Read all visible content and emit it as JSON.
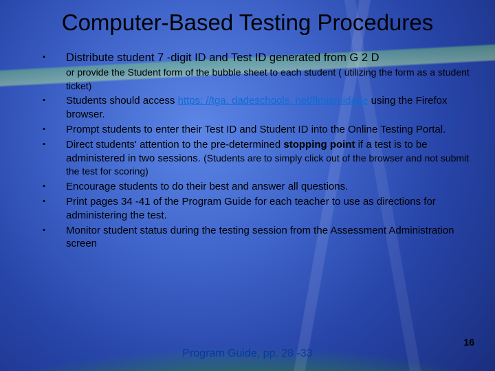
{
  "title": "Computer-Based Testing Procedures",
  "bullets": {
    "b1_line1": "Distribute student 7 -digit ID and Test ID generated from G 2 D",
    "b1_line2": "or provide the Student form of the bubble sheet to each student ( utilizing the form as a student ticket)",
    "b2_pre": "Students should access ",
    "b2_url": "https: //tga. dadeschools. net/flmiamidade",
    "b2_post": " using the Firefox browser.",
    "b3": "Prompt students to enter their Test ID and Student ID into the Online Testing Portal.",
    "b4_pre": "Direct students' attention to the pre-determined ",
    "b4_bold": "stopping point",
    "b4_mid": " if a test is to be administered in two sessions. ",
    "b4_small": "(Students are to simply click out of the browser and not submit the test for scoring)",
    "b5": "Encourage students to do their best and answer all questions.",
    "b6": "Print pages 34 -41 of the Program Guide for each teacher to use as directions for administering the test.",
    "b7": "Monitor student status during the testing session from the Assessment Administration screen"
  },
  "footer": "Program Guide, pp. 28 -33",
  "page_number": "16"
}
